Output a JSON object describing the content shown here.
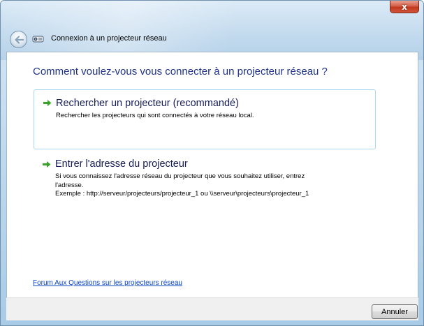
{
  "window": {
    "title": "Connexion à un projecteur réseau",
    "close_glyph": "x",
    "close_icon": "close-icon",
    "back_icon": "back-arrow-icon",
    "app_icon": "network-projector-icon"
  },
  "main": {
    "heading": "Comment voulez-vous vous connecter à un projecteur réseau ?",
    "options": [
      {
        "icon": "green-arrow-icon",
        "title": "Rechercher un projecteur (recommandé)",
        "description_lines": [
          "Rechercher les projecteurs qui sont connectés à votre réseau local."
        ],
        "selected": true
      },
      {
        "icon": "green-arrow-icon",
        "title": "Entrer l'adresse du projecteur",
        "description_lines": [
          "Si vous connaissez l'adresse réseau du projecteur que vous souhaitez utiliser, entrez",
          "l'adresse.",
          "Exemple : http://serveur/projecteurs/projecteur_1 ou \\\\serveur\\projecteurs\\projecteur_1"
        ],
        "selected": false
      }
    ],
    "faq_link": "Forum Aux Questions sur les projecteurs réseau"
  },
  "footer": {
    "cancel_label": "Annuler"
  },
  "colors": {
    "heading": "#1e3287",
    "link": "#0b44c2",
    "arrow": "#3aa12a",
    "selected_border": "#a8d8ef"
  }
}
